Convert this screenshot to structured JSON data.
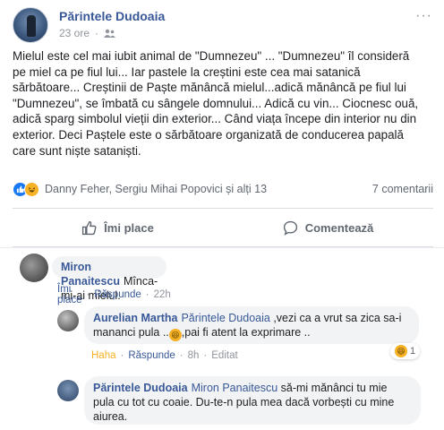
{
  "post": {
    "author": "Părintele Dudoaia",
    "time": "23 ore",
    "audience_icon": "friends-icon",
    "body_lines": [
      "Mielul este cel mai iubit animal de \"Dumnezeu\" ... \"Dumnezeu\" îl consideră",
      "pe miel ca pe fiul lui... Iar pastele la creștini este cea mai satanică",
      "sărbătoare... Creștinii de Paște mănâncă mielul...adică mănâncă pe fiul lui",
      "\"Dumnezeu\", se îmbată cu sângele domnului... Adică cu vin... Ciocnesc ouă,",
      "adică sparg simbolul vieții din exterior... Când viața începe din interior nu din",
      "exterior. Deci Paștele este o sărbătoare organizată de conducerea papală",
      "care sunt niște sataniști."
    ]
  },
  "reactions": {
    "names": "Danny Feher, Sergiu Mihai Popovici și alți 13",
    "comment_count": "7 comentarii"
  },
  "actions": {
    "like_label": "Îmi place",
    "comment_label": "Comentează"
  },
  "comments": [
    {
      "author": "Miron Panaitescu",
      "text": "Mînca-mi-ai mielul.",
      "like_label": "Îmi place",
      "reply_label": "Răspunde",
      "time": "22h"
    },
    {
      "author": "Aurelian Martha",
      "tag": "Părintele Dudoaia",
      "text_line1": ",vezi ca a vrut sa zica sa-i",
      "text_line2a": "mananci pula ..",
      "text_line2b": ",pai fi atent la exprimare ..",
      "reaction_label": "Haha",
      "reply_label": "Răspunde",
      "time": "8h",
      "edited": "Editat",
      "reaction_count": "1"
    },
    {
      "author": "Părintele Dudoaia",
      "tag": "Miron Panaitescu",
      "text_line1": "să-mi mănânci tu mie",
      "text_line2": "pula cu tot cu coaie. Du-te-n pula mea dacă vorbești cu mine",
      "text_line3": "aiurea."
    }
  ],
  "separator": "·",
  "colors": {
    "link": "#385898",
    "like": "#1877f2",
    "haha": "#f7b125"
  }
}
